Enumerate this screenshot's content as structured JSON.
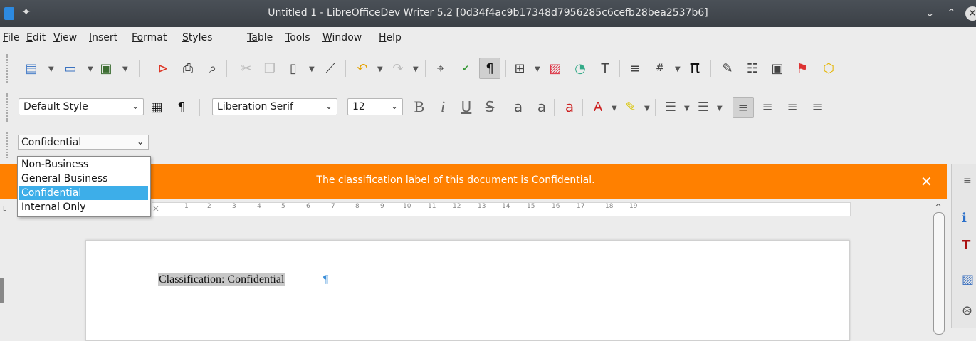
{
  "window": {
    "title": "Untitled 1 - LibreOfficeDev Writer 5.2 [0d34f4ac9b17348d7956285c6cefb28bea2537b6]",
    "icons": [
      "document-icon",
      "pin-icon",
      "chevron-down-icon",
      "chevron-up-icon",
      "close-icon"
    ]
  },
  "menu": {
    "items": [
      {
        "first": "F",
        "rest": "ile"
      },
      {
        "first": "E",
        "rest": "dit"
      },
      {
        "first": "V",
        "rest": "iew"
      },
      {
        "first": "I",
        "rest": "nsert"
      },
      {
        "first": "Fo",
        "rest": "rmat"
      },
      {
        "first": "S",
        "rest": "tyles"
      },
      {
        "first": "Ta",
        "rest": "ble"
      },
      {
        "first": "T",
        "rest": "ools"
      },
      {
        "first": "W",
        "rest": "indow"
      },
      {
        "first": "H",
        "rest": "elp"
      }
    ]
  },
  "format_toolbar": {
    "paragraph_style": "Default Style",
    "font_name": "Liberation Serif",
    "font_size": "12"
  },
  "classification": {
    "selected": "Confidential",
    "options": [
      "Non-Business",
      "General Business",
      "Confidential",
      "Internal Only"
    ]
  },
  "infobar": {
    "message": "The classification label of this document is Confidential.",
    "close_glyph": "✕"
  },
  "ruler": {
    "numbers": [
      "1",
      "2",
      "3",
      "4",
      "5",
      "6",
      "7",
      "8",
      "9",
      "10",
      "11",
      "12",
      "13",
      "14",
      "15",
      "16",
      "17",
      "18",
      "19"
    ]
  },
  "document": {
    "text": "Classification: Confidential",
    "pilcrow": "¶"
  },
  "colors": {
    "infobar": "#ff8000",
    "selection": "#3daee9",
    "titlebar": "#3b4046"
  }
}
